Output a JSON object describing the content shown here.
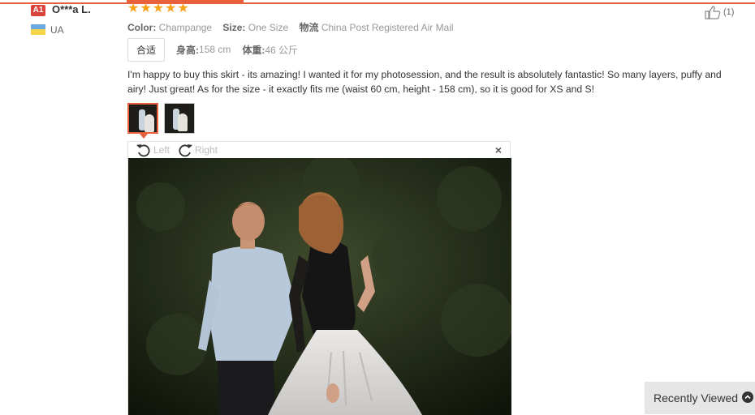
{
  "user": {
    "level_badge": "A1",
    "name": "O***a L.",
    "country": "UA"
  },
  "rating": {
    "stars": "★★★★★"
  },
  "attributes": {
    "color_label": "Color:",
    "color_value": "Champange",
    "size_label": "Size:",
    "size_value": "One Size",
    "shipping_label": "物流",
    "shipping_value": "China Post Registered Air Mail"
  },
  "fit": {
    "badge": "合适",
    "height_label": "身高:",
    "height_value": "158 cm",
    "weight_label": "体重:",
    "weight_value": "46 公斤"
  },
  "review_text": "I'm happy to buy this skirt - its amazing! I wanted it for my photosession, and the result is absolutely fantastic! So many layers, puffy and airy! Just great! As for the size - it exactly fits me (waist 60 cm, height - 158 cm), so it is good for XS and S!",
  "helpful": {
    "count": "(1)"
  },
  "viewer": {
    "rotate_left": "Left",
    "rotate_right": "Right",
    "close": "×"
  },
  "recently_viewed": "Recently Viewed",
  "colors": {
    "accent": "#e8603c",
    "star": "#f7a21b",
    "badge": "#d9433c"
  }
}
